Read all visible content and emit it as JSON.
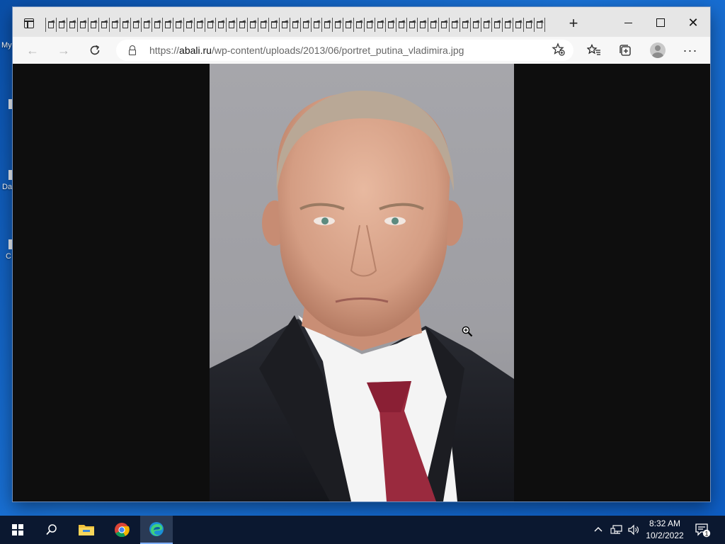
{
  "desktop": {
    "fragments": [
      "My",
      "Da",
      "C"
    ]
  },
  "browser": {
    "tab_count": 47,
    "new_tab_label": "+",
    "address": {
      "scheme": "https://",
      "host": "abali.ru",
      "path": "/wp-content/uploads/2013/06/portret_putina_vladimira.jpg"
    },
    "close_label": "✕",
    "more_label": "···"
  },
  "content": {
    "image_subject": "portrait photo on grey background"
  },
  "taskbar": {
    "time": "8:32 AM",
    "date": "10/2/2022",
    "notification_count": "1",
    "apps": [
      "search-icon",
      "file-explorer-icon",
      "chrome-icon",
      "edge-icon"
    ]
  },
  "colors": {
    "taskbar": "#0b1830",
    "viewport": "#0e0e0e",
    "tabbar": "#e6e6e6"
  }
}
